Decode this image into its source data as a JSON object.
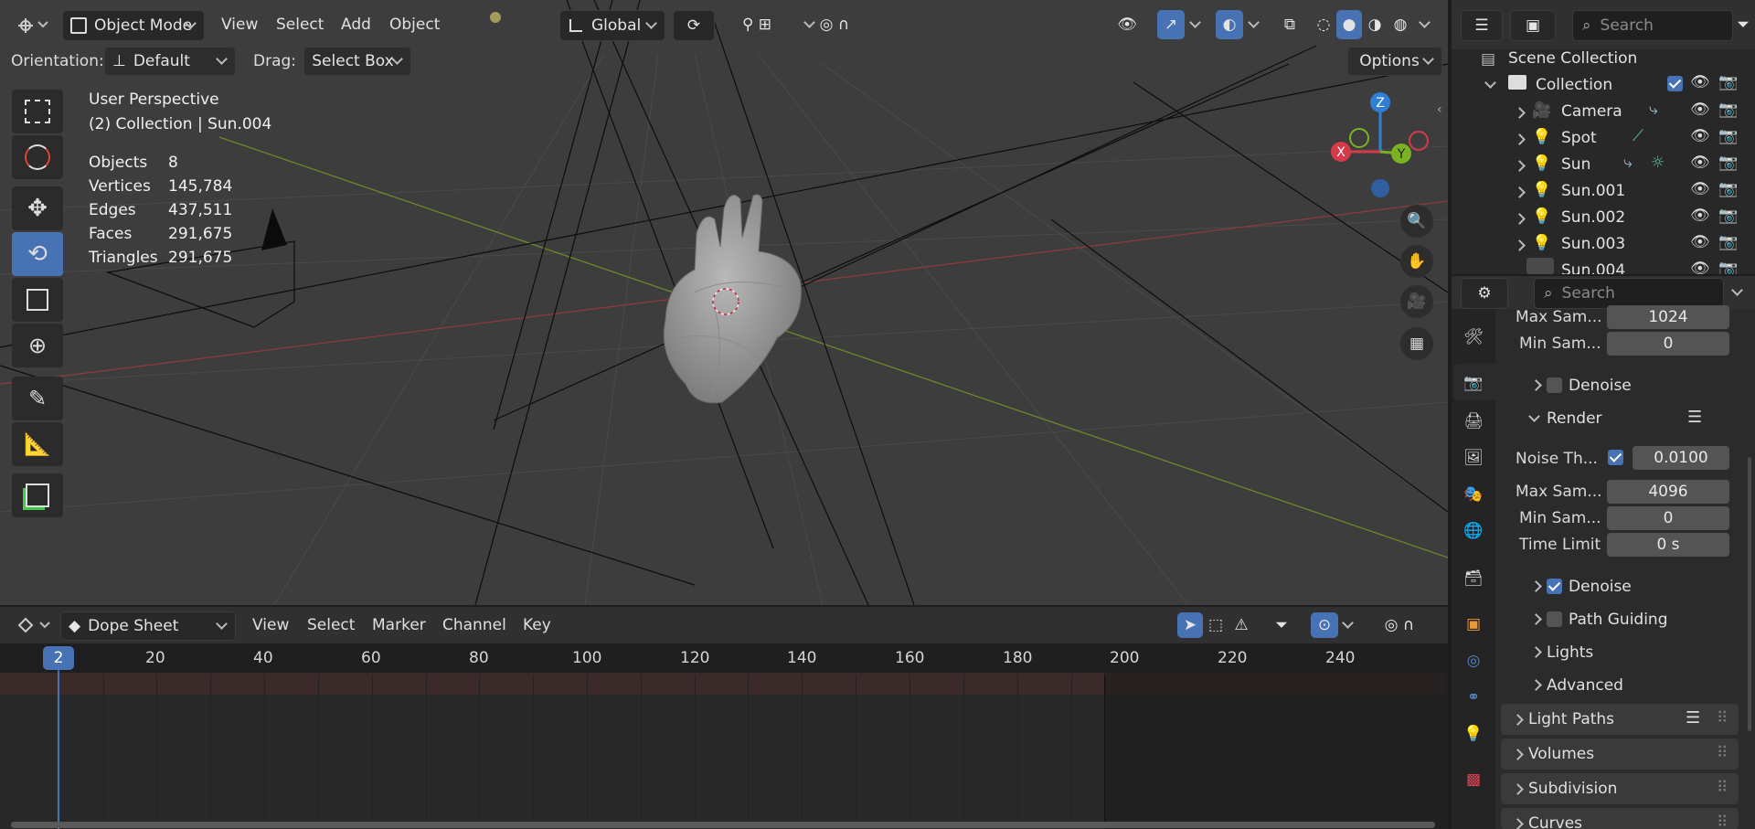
{
  "viewport": {
    "mode": "Object Mode",
    "menus": [
      "View",
      "Select",
      "Add",
      "Object"
    ],
    "transform_orientation": "Global",
    "orientation_label": "Orientation:",
    "orientation_value": "Default",
    "drag_label": "Drag:",
    "drag_value": "Select Box",
    "options_label": "Options",
    "overlay_title": "User Perspective",
    "overlay_context": "(2) Collection | Sun.004",
    "stats": [
      {
        "label": "Objects",
        "value": "8"
      },
      {
        "label": "Vertices",
        "value": "145,784"
      },
      {
        "label": "Edges",
        "value": "437,511"
      },
      {
        "label": "Faces",
        "value": "291,675"
      },
      {
        "label": "Triangles",
        "value": "291,675"
      }
    ],
    "gizmo": {
      "x": "X",
      "y": "Y",
      "z": "Z"
    },
    "colors": {
      "x_axis": "#d63a4a",
      "y_axis": "#7ab321",
      "z_axis": "#2f7fd6",
      "active": "#4772b3"
    }
  },
  "dopesheet": {
    "editor": "Dope Sheet",
    "menus": [
      "View",
      "Select",
      "Marker",
      "Channel",
      "Key"
    ],
    "current_frame": "2",
    "ticks": [
      "20",
      "40",
      "60",
      "80",
      "100",
      "120",
      "140",
      "160",
      "180",
      "200",
      "220",
      "240"
    ]
  },
  "outliner": {
    "search_placeholder": "Search",
    "scene_collection": "Scene Collection",
    "collection": "Collection",
    "items": [
      "Camera",
      "Spot",
      "Sun",
      "Sun.001",
      "Sun.002",
      "Sun.003",
      "Sun.004"
    ]
  },
  "properties": {
    "search_placeholder": "Search",
    "top_fields": [
      {
        "label": "Max Sam...",
        "value": "1024"
      },
      {
        "label": "Min Sam...",
        "value": "0"
      }
    ],
    "denoise_1": "Denoise",
    "render_panel": "Render",
    "noise_label": "Noise Th...",
    "noise_value": "0.0100",
    "render_fields": [
      {
        "label": "Max Sam...",
        "value": "4096"
      },
      {
        "label": "Min Sam...",
        "value": "0"
      },
      {
        "label": "Time Limit",
        "value": "0 s"
      }
    ],
    "sub_panels": [
      "Denoise",
      "Path Guiding",
      "Lights",
      "Advanced"
    ],
    "panels": [
      "Light Paths",
      "Volumes",
      "Subdivision",
      "Curves"
    ]
  }
}
